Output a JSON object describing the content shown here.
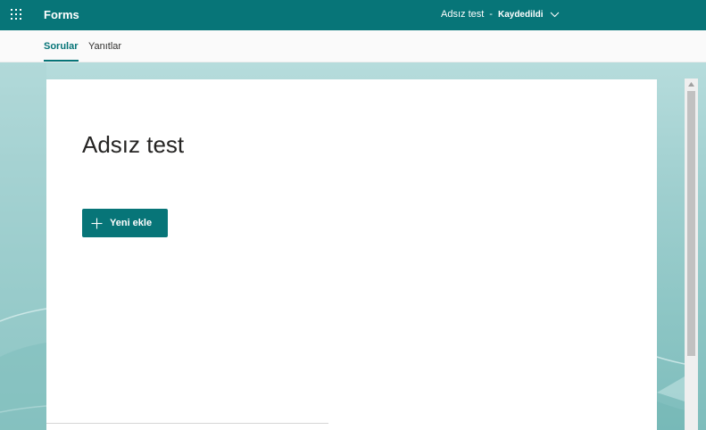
{
  "app": {
    "name": "Forms"
  },
  "doc": {
    "title": "Adsız test",
    "separator": "-",
    "status": "Kaydedildi"
  },
  "tabs": [
    {
      "label": "Sorular",
      "active": true
    },
    {
      "label": "Yanıtlar",
      "active": false
    }
  ],
  "form": {
    "title": "Adsız test",
    "add_new_label": "Yeni ekle"
  },
  "icons": {
    "launcher": "app-launcher-icon",
    "chevron": "chevron-down-icon",
    "plus": "plus-icon",
    "scroll_up": "scroll-up-arrow-icon"
  },
  "colors": {
    "brand": "#077578",
    "tab_active": "#077578",
    "theme_bg": "#9fcfcf"
  }
}
